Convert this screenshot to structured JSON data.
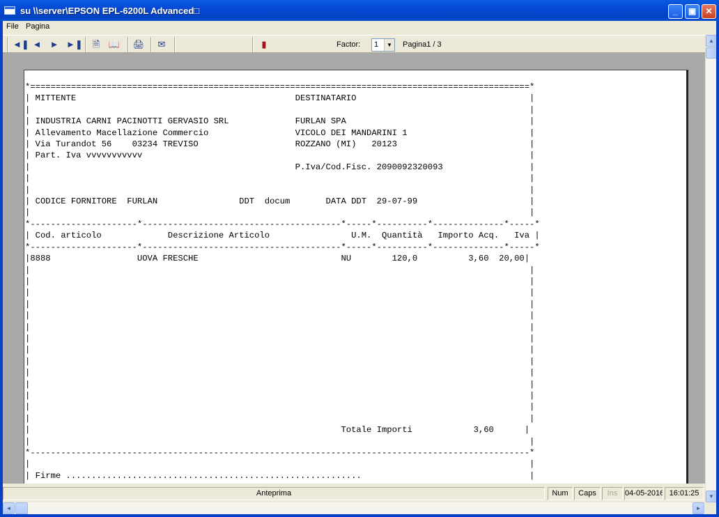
{
  "window": {
    "title": "su \\\\server\\EPSON EPL-6200L Advanced□",
    "controls": {
      "minimize": "_",
      "maximize": "▣",
      "close": "✕"
    }
  },
  "menu": {
    "file": "File",
    "pagina": "Pagina"
  },
  "toolbar": {
    "icons": [
      "first-page-icon",
      "prev-page-icon",
      "next-page-icon",
      "last-page-icon",
      "single-page-icon",
      "two-page-icon",
      "print-icon",
      "export-icon",
      "exit-icon"
    ],
    "factor_label": "Factor:",
    "factor_value": "1",
    "page_label": "Pagina1 / 3"
  },
  "document": {
    "lines": [
      "*==================================================================================================*",
      "| MITTENTE                                           DESTINATARIO                                  |",
      "|                                                                                                  |",
      "| INDUSTRIA CARNI PACINOTTI GERVASIO SRL             FURLAN SPA                                    |",
      "| Allevamento Macellazione Commercio                 VICOLO DEI MANDARINI 1                        |",
      "| Via Turandot 56    03234 TREVISO                   ROZZANO (MI)   20123                          |",
      "| Part. Iva vvvvvvvvvvv                                                                            |",
      "|                                                    P.Iva/Cod.Fisc. 2090092320093                 |",
      "|                                                                                                  |",
      "|                                                                                                  |",
      "| CODICE FORNITORE  FURLAN                DDT  docum       DATA DDT  29-07-99                      |",
      "|                                                                                                  |",
      "*---------------------*---------------------------------------*-----*----------*--------------*-----*",
      "| Cod. articolo             Descrizione Articolo                U.M.  Quantità   Importo Acq.   Iva |",
      "*---------------------*---------------------------------------*-----*----------*--------------*-----*",
      "|8888                 UOVA FRESCHE                            NU        120,0          3,60  20,00|",
      "|                                                                                                  |",
      "|                                                                                                  |",
      "|                                                                                                  |",
      "|                                                                                                  |",
      "|                                                                                                  |",
      "|                                                                                                  |",
      "|                                                                                                  |",
      "|                                                                                                  |",
      "|                                                                                                  |",
      "|                                                                                                  |",
      "|                                                                                                  |",
      "|                                                                                                  |",
      "|                                                                                                  |",
      "|                                                                                                  |",
      "|                                                             Totale Importi            3,60      |",
      "|                                                                                                  |",
      "*--------------------------------------------------------------------------------------------------*",
      "|                                                                                                  |",
      "| Firme ..........................................................                                 |"
    ]
  },
  "statusbar": {
    "mode": "Anteprima",
    "num": "Num",
    "caps": "Caps",
    "ins": "Ins",
    "date": "04-05-2016",
    "time": "16:01:25"
  }
}
